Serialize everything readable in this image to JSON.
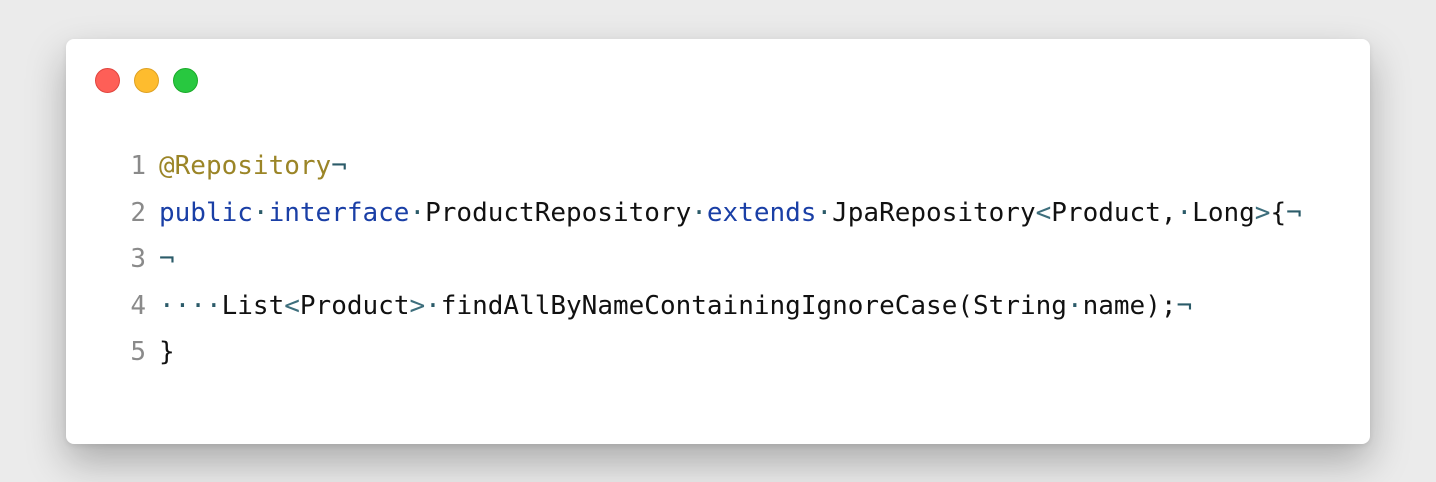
{
  "window": {
    "controls": [
      {
        "name": "close-button",
        "color": "#fe5f57",
        "border": "#e0443e"
      },
      {
        "name": "minimize-button",
        "color": "#febc2e",
        "border": "#dea123"
      },
      {
        "name": "zoom-button",
        "color": "#28c840",
        "border": "#1aab29"
      }
    ]
  },
  "colors": {
    "annotation": "#9b8527",
    "keyword": "#1a3fa6",
    "plain": "#111111",
    "punct": "#3d6e7c",
    "whitespace": "#2b5b69",
    "line_number": "#8a8a8a"
  },
  "code": {
    "lines": [
      {
        "number": "1",
        "tokens": [
          {
            "t": "@Repository",
            "k": "annotation"
          },
          {
            "t": "¬",
            "k": "whitespace"
          }
        ]
      },
      {
        "number": "2",
        "tokens": [
          {
            "t": "public",
            "k": "keyword"
          },
          {
            "t": "·",
            "k": "whitespace"
          },
          {
            "t": "interface",
            "k": "keyword"
          },
          {
            "t": "·",
            "k": "whitespace"
          },
          {
            "t": "ProductRepository",
            "k": "plain"
          },
          {
            "t": "·",
            "k": "whitespace"
          },
          {
            "t": "extends",
            "k": "keyword"
          },
          {
            "t": "·",
            "k": "whitespace"
          },
          {
            "t": "JpaRepository",
            "k": "plain"
          },
          {
            "t": "<",
            "k": "punct"
          },
          {
            "t": "Product,",
            "k": "plain"
          },
          {
            "t": "·",
            "k": "whitespace"
          },
          {
            "t": "Long",
            "k": "plain"
          },
          {
            "t": ">",
            "k": "punct"
          },
          {
            "t": "{",
            "k": "plain"
          },
          {
            "t": "¬",
            "k": "whitespace"
          }
        ]
      },
      {
        "number": "3",
        "tokens": [
          {
            "t": "¬",
            "k": "whitespace"
          }
        ]
      },
      {
        "number": "4",
        "tokens": [
          {
            "t": "····",
            "k": "whitespace"
          },
          {
            "t": "List",
            "k": "plain"
          },
          {
            "t": "<",
            "k": "punct"
          },
          {
            "t": "Product",
            "k": "plain"
          },
          {
            "t": ">",
            "k": "punct"
          },
          {
            "t": "·",
            "k": "whitespace"
          },
          {
            "t": "findAllByNameContainingIgnoreCase(String",
            "k": "plain"
          },
          {
            "t": "·",
            "k": "whitespace"
          },
          {
            "t": "name);",
            "k": "plain"
          },
          {
            "t": "¬",
            "k": "whitespace"
          }
        ]
      },
      {
        "number": "5",
        "tokens": [
          {
            "t": "}",
            "k": "plain"
          }
        ]
      }
    ]
  }
}
